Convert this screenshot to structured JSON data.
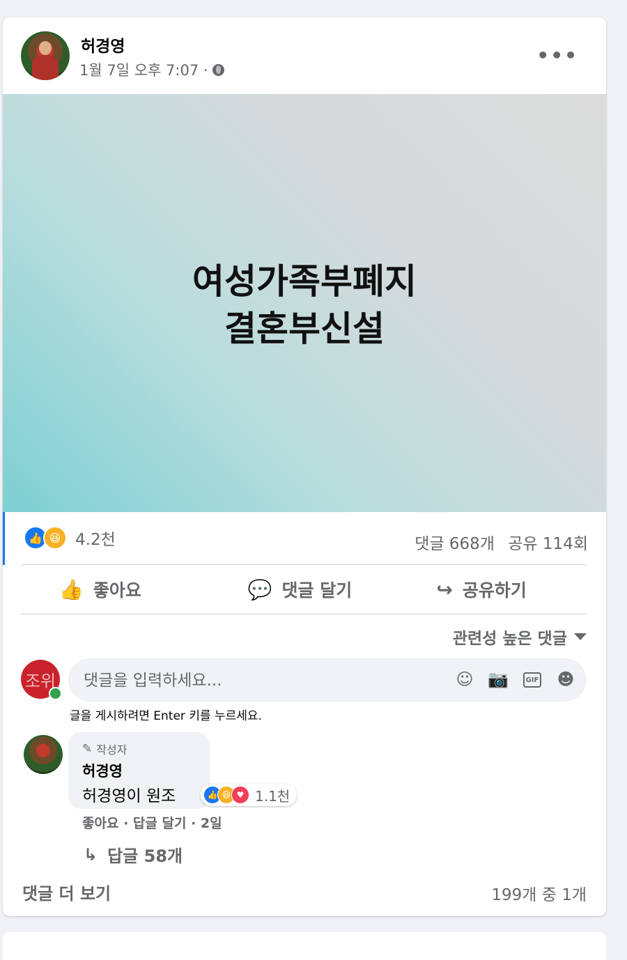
{
  "post": {
    "author": "허경영",
    "timestamp": "1월 7일 오후 7:07 ·",
    "banner_line1": "여성가족부폐지",
    "banner_line2": "결혼부신설",
    "reaction_count": "4.2천",
    "comments_count": "댓글 668개",
    "shares_count": "공유 114회"
  },
  "actions": {
    "like": "좋아요",
    "comment": "댓글 달기",
    "share": "공유하기"
  },
  "sort": {
    "label": "관련성 높은 댓글"
  },
  "composer": {
    "avatar_text": "조위",
    "placeholder": "댓글을 입력하세요...",
    "hint": "글을 게시하려면 Enter 키를 누르세요.",
    "gif_label": "GIF"
  },
  "comment": {
    "badge": "작성자",
    "author": "허경영",
    "text": "허경영이 원조",
    "reaction_count": "1.1천",
    "like": "좋아요",
    "sep1": " · ",
    "reply": "답글 달기",
    "sep2": " · ",
    "age": "2일",
    "replies": "답글 58개"
  },
  "footer": {
    "more_comments": "댓글 더 보기",
    "page_count": "199개 중 1개"
  },
  "colors": {
    "accent": "#1877f2",
    "secondary_text": "#65676b",
    "online": "#31a24c"
  }
}
